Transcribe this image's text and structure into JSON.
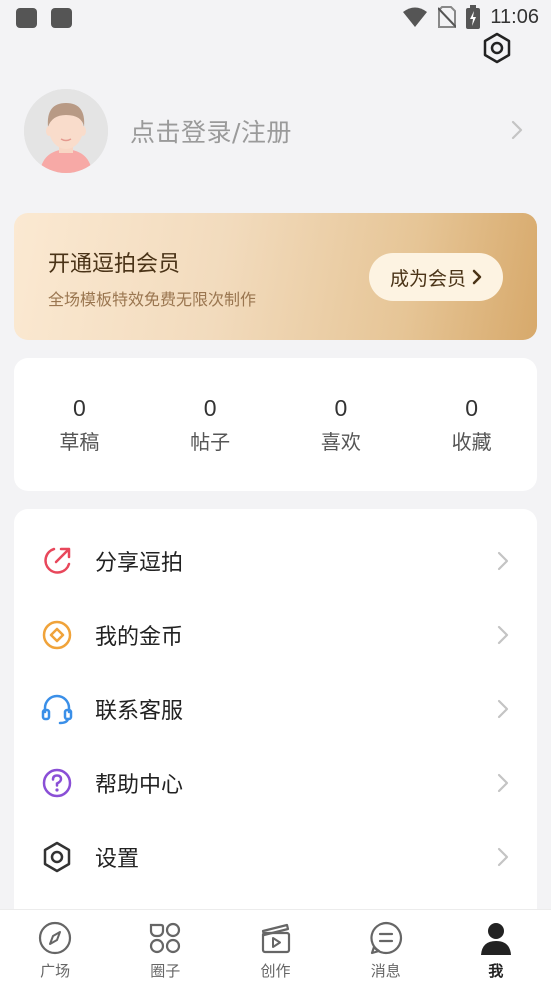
{
  "status_bar": {
    "time": "11:06"
  },
  "profile": {
    "login_text": "点击登录/注册"
  },
  "vip": {
    "title": "开通逗拍会员",
    "subtitle": "全场模板特效免费无限次制作",
    "button_label": "成为会员"
  },
  "stats": [
    {
      "value": "0",
      "label": "草稿"
    },
    {
      "value": "0",
      "label": "帖子"
    },
    {
      "value": "0",
      "label": "喜欢"
    },
    {
      "value": "0",
      "label": "收藏"
    }
  ],
  "menu": [
    {
      "label": "分享逗拍",
      "icon": "share-icon",
      "color": "#e8475b"
    },
    {
      "label": "我的金币",
      "icon": "coin-icon",
      "color": "#f0a33a"
    },
    {
      "label": "联系客服",
      "icon": "headset-icon",
      "color": "#3a8fe8"
    },
    {
      "label": "帮助中心",
      "icon": "help-icon",
      "color": "#8a4fd6"
    },
    {
      "label": "设置",
      "icon": "gear-icon",
      "color": "#333333"
    }
  ],
  "bottom_nav": [
    {
      "label": "广场",
      "icon": "compass-icon",
      "active": false
    },
    {
      "label": "圈子",
      "icon": "grid-icon",
      "active": false
    },
    {
      "label": "创作",
      "icon": "clapperboard-icon",
      "active": false
    },
    {
      "label": "消息",
      "icon": "message-icon",
      "active": false
    },
    {
      "label": "我",
      "icon": "person-icon",
      "active": true
    }
  ]
}
